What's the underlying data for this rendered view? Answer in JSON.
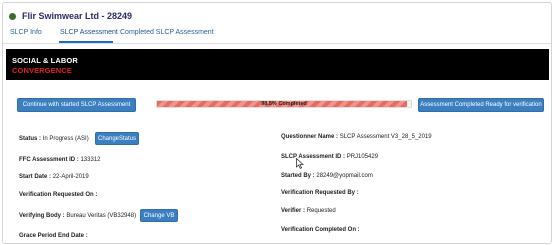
{
  "header": {
    "title": "Flir Swimwear Ltd - 28249",
    "status_color": "#3c6b2e"
  },
  "tabs": [
    {
      "label": "SLCP Info"
    },
    {
      "label": "SLCP Assessment"
    },
    {
      "label": "Completed SLCP Assessment"
    }
  ],
  "banner": {
    "line1": "SOCIAL & LABOR",
    "line2": "CONVERGENCE"
  },
  "actions": {
    "continue_label": "Continue with started SLCP Assessment",
    "completed_label": "Assessment Completed Ready for verification"
  },
  "progress": {
    "text": "98.5% Completed",
    "value": 0.985
  },
  "left_fields": {
    "status_label": "Status :",
    "status_value": "In Progress (ASI)",
    "change_status_label": "ChangeStatus",
    "ffc_label": "FFC Assessment ID :",
    "ffc_value": "133312",
    "start_label": "Start Date :",
    "start_value": "22-April-2019",
    "verification_requested_label": "Verification Requested On :",
    "verifying_body_label": "Verifying Body :",
    "verifying_body_value": "Bureau Veritas (VB32948)",
    "change_vb_label": "Change VB",
    "grace_label": "Grace Period End Date :"
  },
  "right_fields": {
    "questionnaire_label": "Questionner Name :",
    "questionnaire_value": "SLCP Assessment V3_28_5_2019",
    "slcp_id_label": "SLCP Assessment ID :",
    "slcp_id_value": "PRJ105429",
    "started_by_label": "Started By :",
    "started_by_value": "28249@yopmail.com",
    "verification_requested_by_label": "Verification Requested By :",
    "verifier_label": "Verifier :",
    "verifier_value": "Requested",
    "verification_completed_label": "Verification Completed On :"
  },
  "colors": {
    "accent": "#3b7fc0",
    "banner_bg": "#000000",
    "banner_red": "#e02020",
    "progress": "#e86a60"
  }
}
